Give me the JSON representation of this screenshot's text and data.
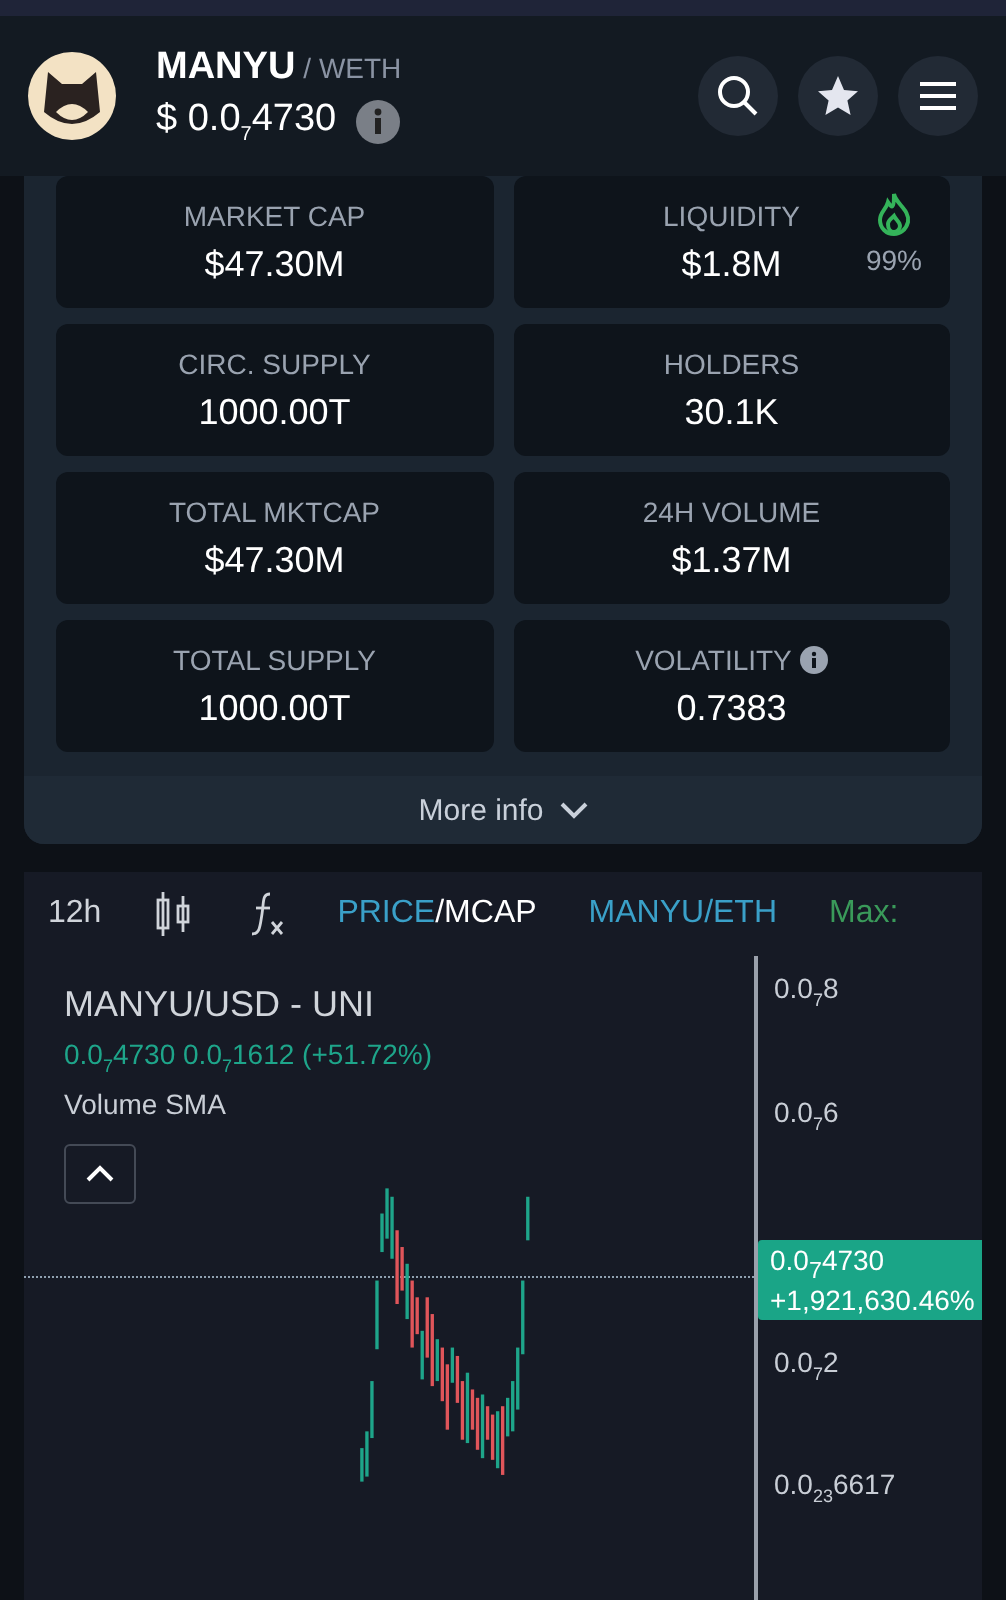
{
  "header": {
    "symbol": "MANYU",
    "pair": "/ WETH",
    "price": "$ 0.0$_{7}$4730"
  },
  "stats": [
    {
      "label": "MARKET CAP",
      "value": "$47.30M"
    },
    {
      "label": "LIQUIDITY",
      "value": "$1.8M",
      "badge": "99%"
    },
    {
      "label": "CIRC. SUPPLY",
      "value": "1000.00T"
    },
    {
      "label": "HOLDERS",
      "value": "30.1K"
    },
    {
      "label": "TOTAL MKTCAP",
      "value": "$47.30M"
    },
    {
      "label": "24H VOLUME",
      "value": "$1.37M"
    },
    {
      "label": "TOTAL SUPPLY",
      "value": "1000.00T"
    },
    {
      "label": "VOLATILITY",
      "value": "0.7383",
      "info": true
    }
  ],
  "more_info": "More info",
  "toolbar": {
    "interval": "12h",
    "price": "PRICE",
    "mcap": "/MCAP",
    "pair": "MANYU/ETH",
    "max": "Max:"
  },
  "chart": {
    "title": "MANYU/USD - UNI",
    "quote": "0.0$_{7}$4730  0.0$_{7}$1612 (+51.72%)",
    "indicator": "Volume SMA",
    "axis": [
      "0.0$_{7}$8",
      "0.0$_{7}$6",
      "0.0$_{7}$2",
      "0.0$_{23}$6617"
    ],
    "last": [
      "0.0$_{7}$4730",
      "+1,921,630.46%"
    ]
  }
}
